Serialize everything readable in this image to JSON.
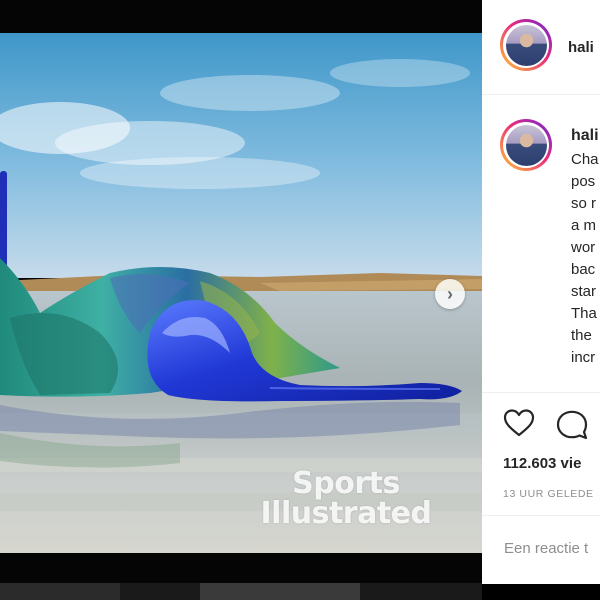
{
  "header": {
    "username": "hali"
  },
  "caption": {
    "username": "hali",
    "lines": [
      "Cha",
      "pos",
      "so r",
      "a m",
      "wor",
      "bac",
      "star",
      "Tha",
      "the",
      "incr"
    ]
  },
  "actions": {
    "like_icon": "heart-icon",
    "comment_icon": "comment-icon"
  },
  "stats": {
    "views": "112.603 vie",
    "time_ago": "13 UUR GELEDE"
  },
  "comment_box": {
    "placeholder": "Een reactie t"
  },
  "photo": {
    "watermark_line1": "Sports",
    "watermark_line2": "Illustrated",
    "next_glyph": "›",
    "carousel_total": 2,
    "carousel_active": 1
  },
  "colors": {
    "avatar_ring_start": "#f9ce34",
    "avatar_ring_mid": "#ee2a7b",
    "avatar_ring_end": "#6228d7",
    "carousel_active_dot": "#3aa0ff"
  }
}
